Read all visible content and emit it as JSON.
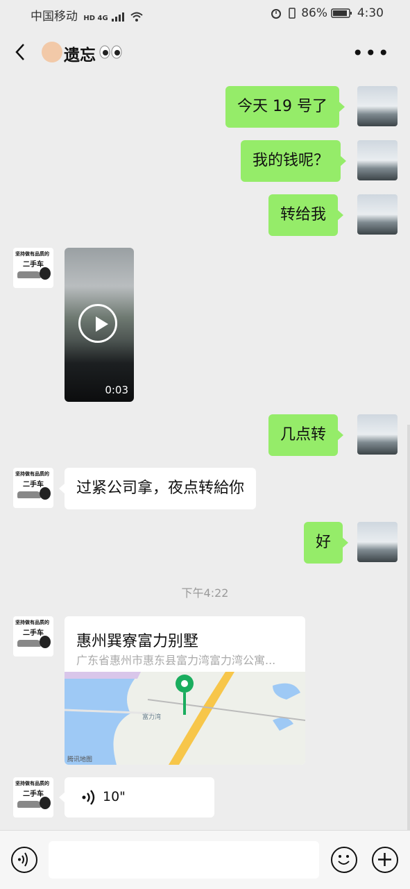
{
  "status_bar": {
    "carrier": "中国移动",
    "network": "HD 4G",
    "battery": "86%",
    "time": "4:30"
  },
  "header": {
    "contact_name": "遗忘"
  },
  "messages": [
    {
      "from": "me",
      "text": "今天 19 号了"
    },
    {
      "from": "me",
      "text": "我的钱呢？"
    },
    {
      "from": "me",
      "text": "转给我"
    },
    {
      "from": "other",
      "type": "video",
      "duration": "0:03"
    },
    {
      "from": "me",
      "text": "几点转"
    },
    {
      "from": "other",
      "text": "过紧公司拿，夜点转給你"
    },
    {
      "from": "me",
      "text": "好"
    }
  ],
  "timestamp": "下午4:22",
  "location": {
    "title": "惠州巽寮富力别墅",
    "address": "广东省惠州市惠东县富力湾富力湾公寓...",
    "map_labels": [
      "富力湾",
      "腾讯地图"
    ]
  },
  "voice": {
    "duration": "10\""
  },
  "avatar_text": {
    "line1": "坚持做有品质的",
    "line2": "二手车"
  },
  "colors": {
    "my_bubble": "#95ec69",
    "other_bubble": "#ffffff",
    "background": "#ededed"
  }
}
